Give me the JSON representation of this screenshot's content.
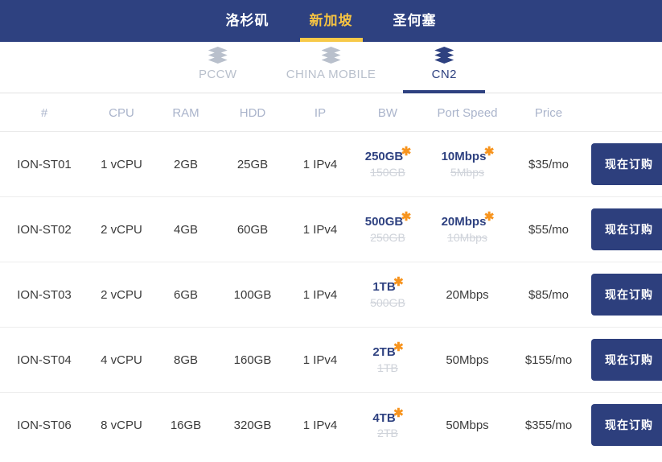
{
  "region_nav": {
    "tabs": [
      {
        "label": "洛杉矶",
        "active": false
      },
      {
        "label": "新加坡",
        "active": true
      },
      {
        "label": "圣何塞",
        "active": false
      }
    ]
  },
  "line_nav": {
    "tabs": [
      {
        "label": "PCCW",
        "icon": "layers-stack-icon",
        "active": false
      },
      {
        "label": "CHINA MOBILE",
        "icon": "layers-stack-icon",
        "active": false
      },
      {
        "label": "CN2",
        "icon": "layers-stack-icon",
        "active": true
      }
    ]
  },
  "table": {
    "headers": [
      "#",
      "CPU",
      "RAM",
      "HDD",
      "IP",
      "BW",
      "Port Speed",
      "Price",
      ""
    ],
    "order_label": "现在订购",
    "star": "✱",
    "rows": [
      {
        "id": "ION-ST01",
        "cpu": "1 vCPU",
        "ram": "2GB",
        "hdd": "25GB",
        "ip": "1 IPv4",
        "bw_new": "250GB",
        "bw_old": "150GB",
        "port_new": "10Mbps",
        "port_old": "5Mbps",
        "port_plain": "",
        "price": "$35/mo"
      },
      {
        "id": "ION-ST02",
        "cpu": "2 vCPU",
        "ram": "4GB",
        "hdd": "60GB",
        "ip": "1 IPv4",
        "bw_new": "500GB",
        "bw_old": "250GB",
        "port_new": "20Mbps",
        "port_old": "10Mbps",
        "port_plain": "",
        "price": "$55/mo"
      },
      {
        "id": "ION-ST03",
        "cpu": "2 vCPU",
        "ram": "6GB",
        "hdd": "100GB",
        "ip": "1 IPv4",
        "bw_new": "1TB",
        "bw_old": "500GB",
        "port_new": "",
        "port_old": "",
        "port_plain": "20Mbps",
        "price": "$85/mo"
      },
      {
        "id": "ION-ST04",
        "cpu": "4 vCPU",
        "ram": "8GB",
        "hdd": "160GB",
        "ip": "1 IPv4",
        "bw_new": "2TB",
        "bw_old": "1TB",
        "port_new": "",
        "port_old": "",
        "port_plain": "50Mbps",
        "price": "$155/mo"
      },
      {
        "id": "ION-ST06",
        "cpu": "8 vCPU",
        "ram": "16GB",
        "hdd": "320GB",
        "ip": "1 IPv4",
        "bw_new": "4TB",
        "bw_old": "2TB",
        "port_new": "",
        "port_old": "",
        "port_plain": "50Mbps",
        "price": "$355/mo"
      }
    ]
  },
  "colors": {
    "nav_bg": "#2e4180",
    "nav_active_text": "#f5c342",
    "nav_active_underline": "#f7c948",
    "line_inactive": "#b9c0cc",
    "line_active": "#2e4180",
    "header_text": "#aab4cb",
    "new_value": "#2e4180",
    "old_value": "#cfd3da",
    "star": "#f7941e",
    "button_bg": "#2d3f7d"
  }
}
